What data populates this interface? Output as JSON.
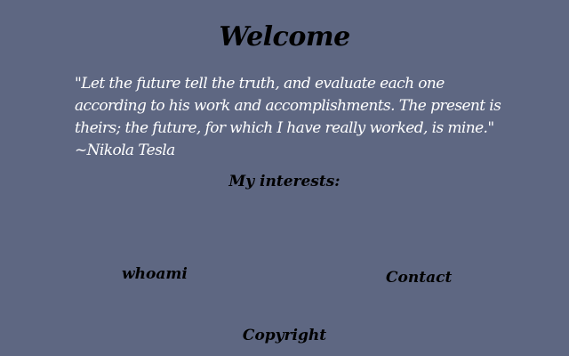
{
  "page": {
    "title": "Welcome",
    "quote": "\"Let the future tell the truth, and evaluate each one according to his work and accomplishments. The present is theirs; the future, for which I have really worked, is mine.\" ~Nikola Tesla",
    "interests_heading": "My interests:",
    "footer": "Copyright"
  },
  "nav": {
    "whoami_label": "whoami",
    "contact_label": "Contact"
  },
  "colors": {
    "background": "#5e6782",
    "heading_text": "#000000",
    "quote_text": "#ffffff"
  }
}
